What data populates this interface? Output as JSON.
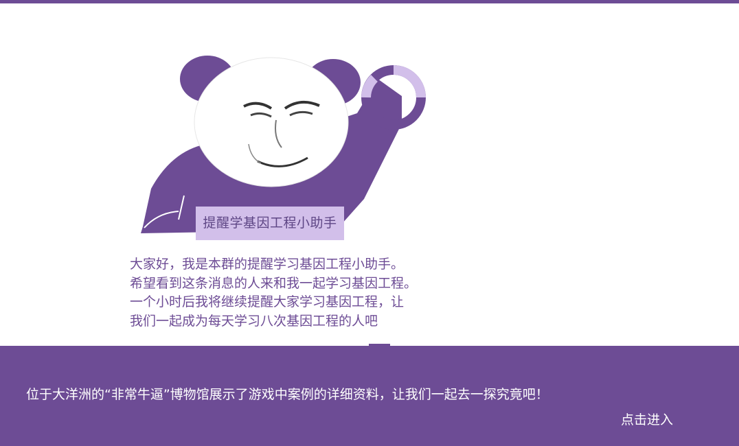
{
  "colors": {
    "accent": "#6d4c95",
    "label_bg": "#d2bfea",
    "text": "#6d4c95",
    "banner_text": "#ffffff"
  },
  "meme": {
    "icon": "panda-face-meme-icon",
    "caption": "提醒学基因工程小助手"
  },
  "message": {
    "lines": [
      "大家好，我是本群的提醒学习基因工程小助手。",
      "希望看到这条消息的人来和我一起学习基因工程。",
      "一个小时后我将继续提醒大家学习基因工程，让",
      "我们一起成为每天学习八次基因工程的人吧"
    ]
  },
  "banner": {
    "text": "位于大洋洲的“非常牛逼”博物馆展示了游戏中案例的详细资料，让我们一起去一探究竟吧！",
    "enter_label": "点击进入"
  }
}
